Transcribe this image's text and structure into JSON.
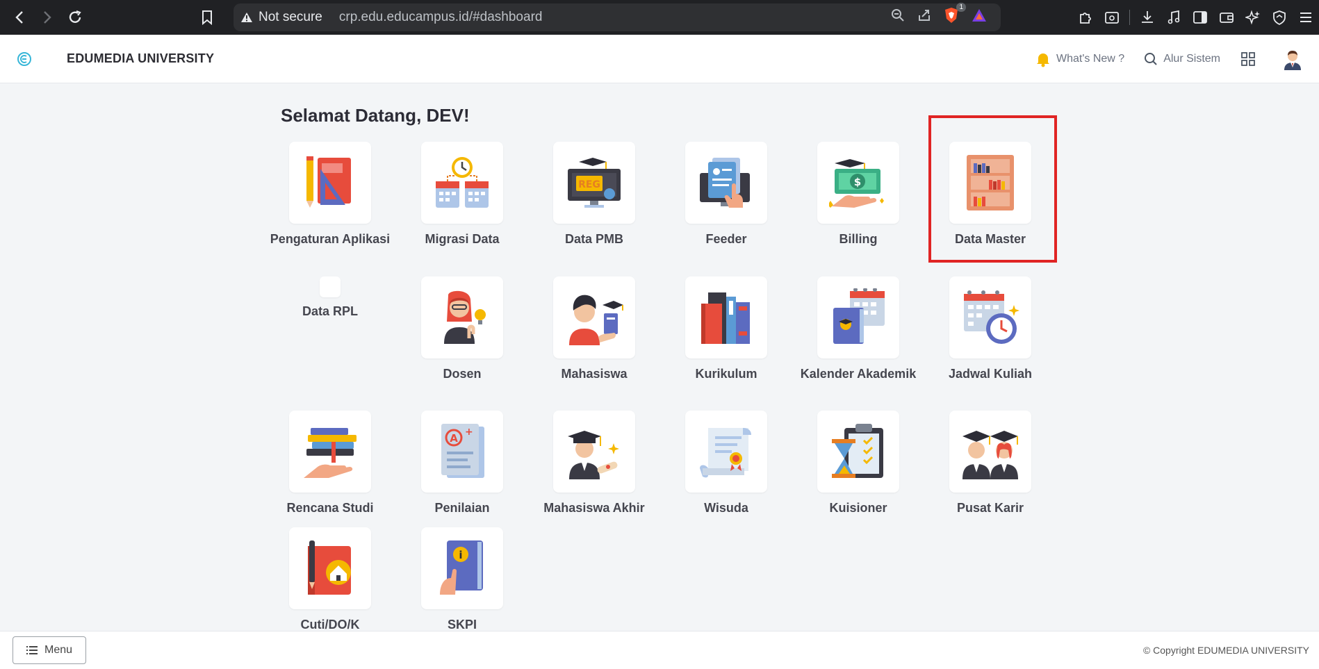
{
  "browser": {
    "security_label": "Not secure",
    "url": "crp.edu.educampus.id/#dashboard",
    "brave_badge": "1"
  },
  "app": {
    "brand": "EDUMEDIA UNIVERSITY",
    "whats_new": "What's New ?",
    "alur_sistem": "Alur Sistem"
  },
  "dashboard": {
    "welcome": "Selamat Datang, DEV!",
    "tiles": [
      {
        "label": "Pengaturan Aplikasi",
        "icon": "stationery-icon"
      },
      {
        "label": "Migrasi Data",
        "icon": "calendar-clock-icon"
      },
      {
        "label": "Data PMB",
        "icon": "registration-monitor-icon"
      },
      {
        "label": "Feeder",
        "icon": "document-upload-icon"
      },
      {
        "label": "Billing",
        "icon": "money-hand-icon"
      },
      {
        "label": "Data Master",
        "icon": "bookshelf-icon"
      },
      {
        "label": "Data RPL",
        "icon": "blank-icon"
      },
      {
        "label": "Dosen",
        "icon": "lecturer-icon"
      },
      {
        "label": "Mahasiswa",
        "icon": "student-icon"
      },
      {
        "label": "Kurikulum",
        "icon": "books-icon"
      },
      {
        "label": "Kalender Akademik",
        "icon": "academic-calendar-icon"
      },
      {
        "label": "Jadwal Kuliah",
        "icon": "schedule-clock-icon"
      },
      {
        "label": "Rencana Studi",
        "icon": "book-stack-hand-icon"
      },
      {
        "label": "Penilaian",
        "icon": "grade-paper-icon"
      },
      {
        "label": "Mahasiswa Akhir",
        "icon": "graduate-diploma-icon"
      },
      {
        "label": "Wisuda",
        "icon": "certificate-scroll-icon"
      },
      {
        "label": "Kuisioner",
        "icon": "checklist-hourglass-icon"
      },
      {
        "label": "Pusat Karir",
        "icon": "graduates-icon"
      },
      {
        "label": "Cuti/DO/K",
        "icon": "notebook-home-icon"
      },
      {
        "label": "SKPI",
        "icon": "info-book-icon"
      }
    ]
  },
  "footer": {
    "menu_label": "Menu",
    "copyright": "© Copyright EDUMEDIA UNIVERSITY"
  },
  "colors": {
    "highlight": "#e02424",
    "page_bg": "#f3f5f7",
    "chrome_bg": "#202124"
  }
}
